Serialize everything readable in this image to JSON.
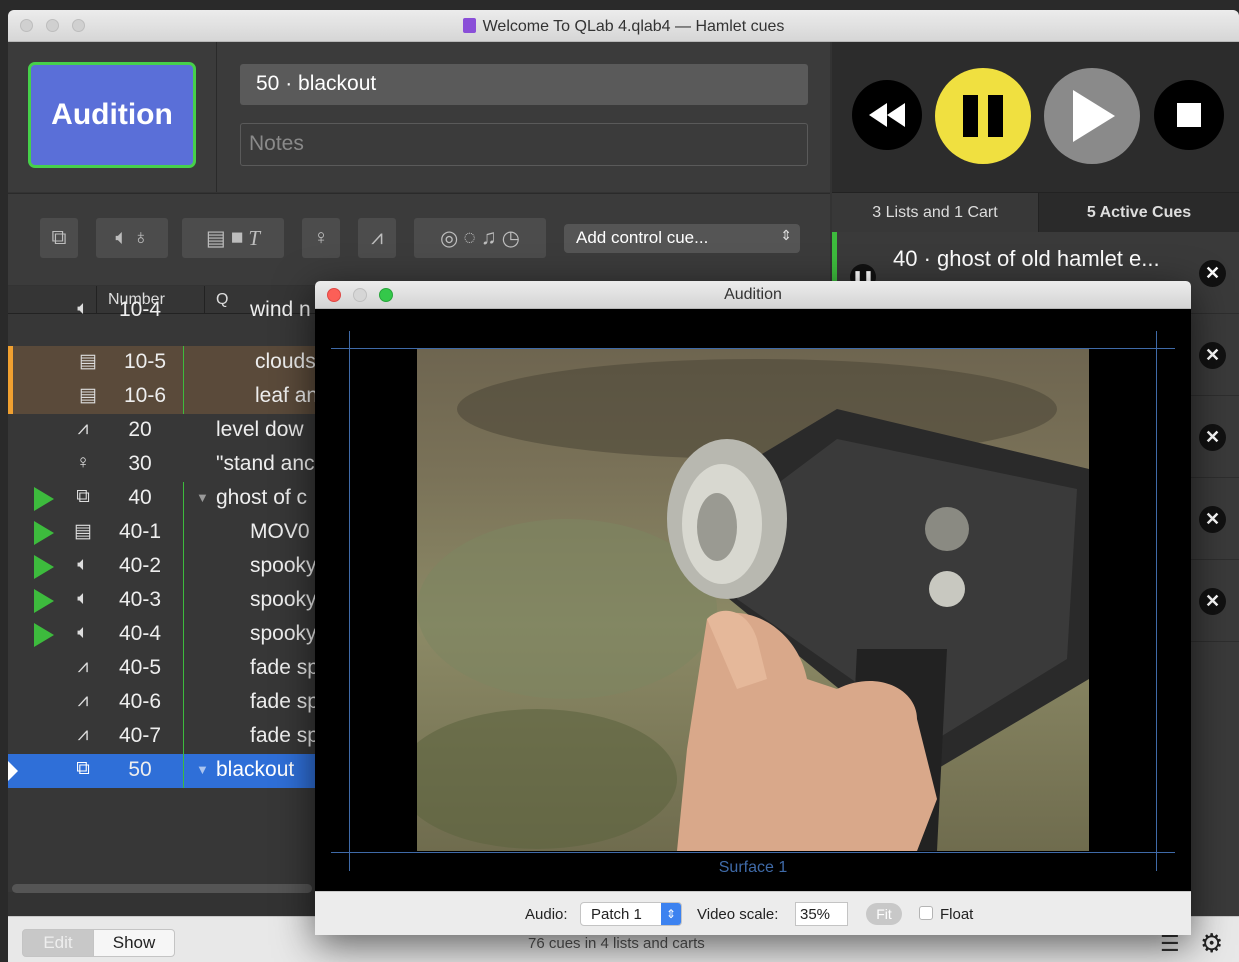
{
  "window": {
    "title": "Welcome To QLab 4.qlab4 — Hamlet cues"
  },
  "audition_button": {
    "label": "Audition"
  },
  "inspector": {
    "cue_name": "50 · blackout",
    "notes_placeholder": "Notes"
  },
  "toolbar": {
    "add_control_cue": "Add control cue..."
  },
  "tabs": {
    "lists": "3 Lists and 1 Cart",
    "active": "5 Active Cues"
  },
  "active_cues": [
    {
      "label": "40 · ghost of old hamlet e..."
    }
  ],
  "list_header": {
    "number": "Number",
    "q": "Q"
  },
  "cues": [
    {
      "num": "10-4",
      "q": "wind n",
      "icon": "speaker-icon"
    },
    {
      "num": "10-5",
      "q": "clouds",
      "icon": "film-icon"
    },
    {
      "num": "10-6",
      "q": "leaf an",
      "icon": "film-icon"
    },
    {
      "num": "20",
      "q": "level dow",
      "icon": "fade-icon"
    },
    {
      "num": "30",
      "q": "\"stand anc",
      "icon": "lightbulb-icon"
    },
    {
      "num": "40",
      "q": "ghost of c",
      "icon": "group-icon"
    },
    {
      "num": "40-1",
      "q": "MOV0",
      "icon": "film-icon"
    },
    {
      "num": "40-2",
      "q": "spooky",
      "icon": "speaker-icon"
    },
    {
      "num": "40-3",
      "q": "spooky",
      "icon": "speaker-icon"
    },
    {
      "num": "40-4",
      "q": "spooky",
      "icon": "speaker-icon"
    },
    {
      "num": "40-5",
      "q": "fade sp",
      "icon": "fade-icon"
    },
    {
      "num": "40-6",
      "q": "fade sp",
      "icon": "fade-icon"
    },
    {
      "num": "40-7",
      "q": "fade sp",
      "icon": "fade-icon"
    },
    {
      "num": "50",
      "q": "blackout",
      "icon": "group-icon"
    }
  ],
  "bottom": {
    "edit": "Edit",
    "show": "Show",
    "status": "76 cues in 4 lists and carts"
  },
  "audition_window": {
    "title": "Audition",
    "surface": "Surface 1",
    "audio_label": "Audio:",
    "audio_value": "Patch 1",
    "video_scale_label": "Video scale:",
    "video_scale_value": "35%",
    "fit": "Fit",
    "float": "Float"
  },
  "colors": {
    "accent": "#5a6fd8",
    "go": "#3dbb3d",
    "pause": "#f0e040",
    "selected": "#2f6fd8"
  }
}
